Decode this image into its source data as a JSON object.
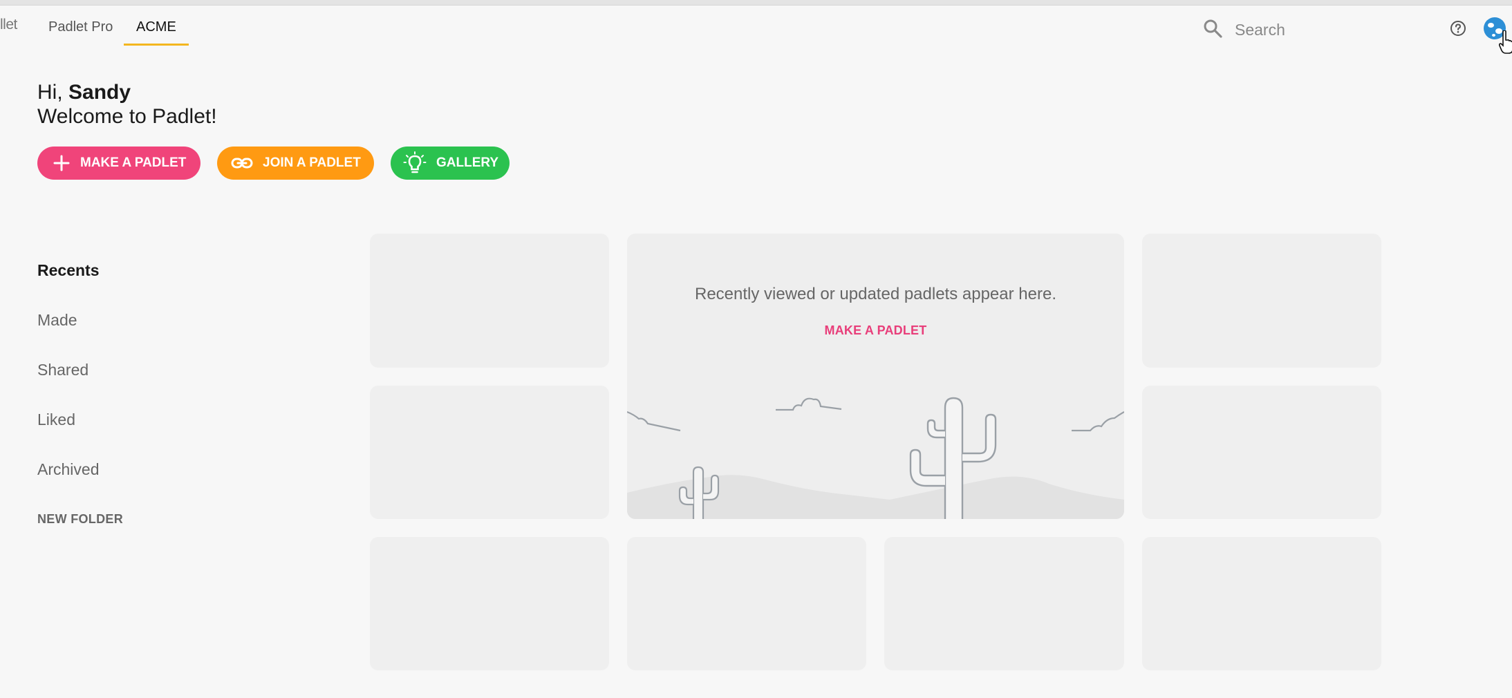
{
  "header": {
    "brand_fragment": "llet",
    "tabs": [
      {
        "label": "Padlet Pro",
        "active": false
      },
      {
        "label": "ACME",
        "active": true
      }
    ],
    "search": {
      "placeholder": "Search",
      "icon": "search-icon"
    },
    "help_icon": "help-icon",
    "avatar_icon": "avatar"
  },
  "greeting": {
    "hi": "Hi, ",
    "name": "Sandy",
    "welcome": "Welcome to Padlet!"
  },
  "actions": [
    {
      "label": "MAKE A PADLET",
      "icon": "plus-icon",
      "color": "#f0447a"
    },
    {
      "label": "JOIN A PADLET",
      "icon": "link-icon",
      "color": "#ff9a12"
    },
    {
      "label": "GALLERY",
      "icon": "lightbulb-icon",
      "color": "#2bc24f"
    }
  ],
  "sidebar": {
    "items": [
      {
        "label": "Recents",
        "active": true
      },
      {
        "label": "Made",
        "active": false
      },
      {
        "label": "Shared",
        "active": false
      },
      {
        "label": "Liked",
        "active": false
      },
      {
        "label": "Archived",
        "active": false
      }
    ],
    "new_folder": "NEW FOLDER"
  },
  "empty_state": {
    "message": "Recently viewed or updated padlets appear here.",
    "cta": "MAKE A PADLET"
  },
  "colors": {
    "accent_tab_underline": "#f3b61f",
    "cta_pink": "#e83e7a",
    "background": "#f7f7f7"
  }
}
